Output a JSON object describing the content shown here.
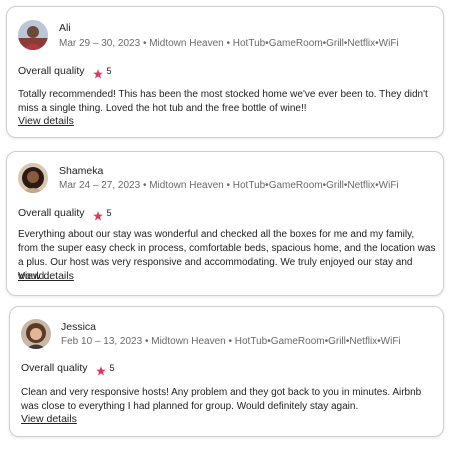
{
  "reviews": [
    {
      "reviewer": "Ali",
      "stay": "Mar 29 – 30, 2023 • Midtown Heaven • HotTub•GameRoom•Grill•Netflix•WiFi",
      "rating_label": "Overall quality",
      "rating": "5",
      "text": "Totally recommended! This has been the most stocked home we've ever been to. They didn't miss a single thing. Loved the hot tub and the free bottle of wine!!",
      "link": "View details"
    },
    {
      "reviewer": "Shameka",
      "stay": "Mar 24 – 27, 2023 • Midtown Heaven • HotTub•GameRoom•Grill•Netflix•WiFi",
      "rating_label": "Overall quality",
      "rating": "5",
      "text": "Everything about our stay was wonderful and checked all the boxes for me and my family, from the super easy check in process, comfortable beds, spacious home, and the location was a plus. Our host was very responsive and accommodating. We truly enjoyed our stay and would...",
      "link": "View details"
    },
    {
      "reviewer": "Jessica",
      "stay": "Feb 10 – 13, 2023 • Midtown Heaven • HotTub•GameRoom•Grill•Netflix•WiFi",
      "rating_label": "Overall quality",
      "rating": "5",
      "text": "Clean and very responsive hosts! Any problem and they got back to you in minutes. Airbnb was close to everything I had planned for group. Would definitely stay again.",
      "link": "View details"
    }
  ],
  "colors": {
    "star": "#e0385a",
    "meta_text": "#6a6a6a",
    "card_border": "#cfcfcf"
  },
  "icons": {
    "rating": "star-icon"
  }
}
